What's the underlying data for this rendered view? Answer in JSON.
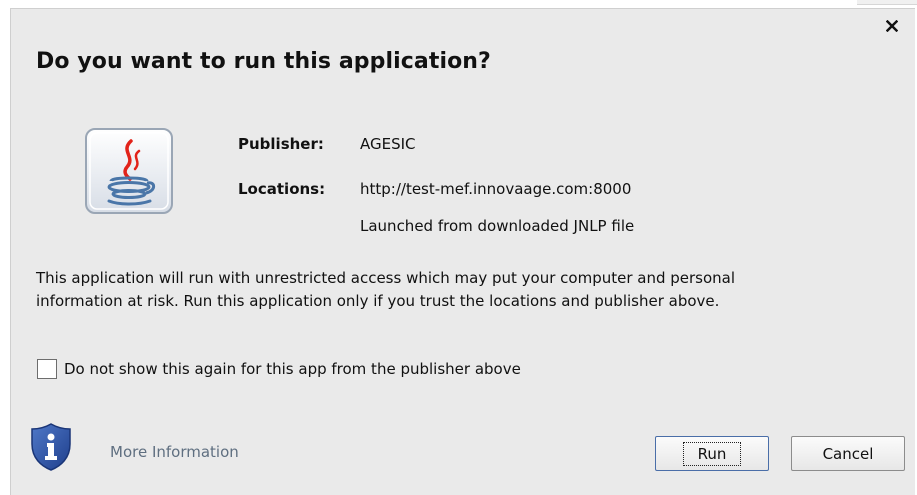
{
  "dialog": {
    "title": "Do you want to run this application?",
    "close_icon": "close-icon"
  },
  "app_info": {
    "icon": "java-icon",
    "publisher_label": "Publisher:",
    "publisher_value": "AGESIC",
    "locations_label": "Locations:",
    "location_url": "http://test-mef.innovaage.com:8000",
    "location_note": "Launched from downloaded JNLP file"
  },
  "warning": {
    "line1": "This application will run with unrestricted access which may put your computer and personal",
    "line2": "information at risk. Run this application only if you trust the locations and publisher above."
  },
  "checkbox": {
    "label": "Do not show this again for this app from the publisher above",
    "checked": false
  },
  "footer": {
    "info_icon": "shield-info-icon",
    "more_info_label": "More Information",
    "run_label": "Run",
    "cancel_label": "Cancel"
  },
  "colors": {
    "dialog_bg": "#eaeaea",
    "link": "#5f6f80",
    "shield_blue": "#2b4f9e"
  }
}
